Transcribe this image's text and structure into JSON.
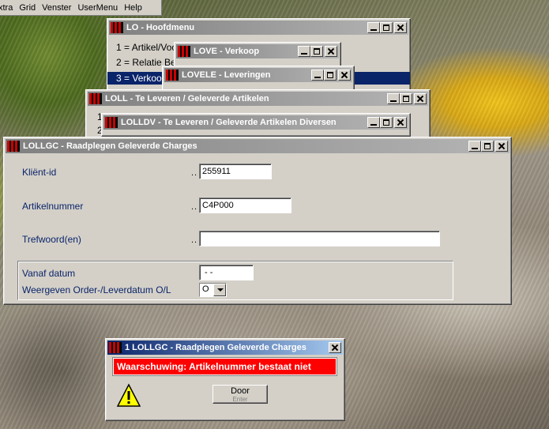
{
  "menubar": {
    "items": [
      "xtra",
      "Grid",
      "Venster",
      "UserMenu",
      "Help"
    ]
  },
  "windows": {
    "hoofdmenu": {
      "title": "LO - Hoofdmenu",
      "items": [
        "1 = Artikel/Voo",
        "2 = Relatie Be",
        "3 = Verkoop"
      ]
    },
    "verkoop": {
      "title": "LOVE - Verkoop"
    },
    "leveringen": {
      "title": "LOVELE - Leveringen"
    },
    "loll": {
      "title": "LOLL - Te Leveren / Geleverde Artikelen",
      "items": [
        "1",
        "2"
      ]
    },
    "lolldv": {
      "title": "LOLLDV - Te Leveren / Geleverde Artikelen Diversen"
    },
    "lollgc": {
      "title": "LOLLGC - Raadplegen Geleverde Charges",
      "form": {
        "klient_label": "Kliënt-id",
        "klient_value": "255911",
        "artikel_label": "Artikelnummer",
        "artikel_value": "C4P000",
        "trefwoord_label": "Trefwoord(en)",
        "trefwoord_value": "",
        "vanaf_label": "Vanaf datum",
        "vanaf_value": " - -",
        "weergeven_label": "Weergeven Order-/Leverdatum O/L",
        "weergeven_value": "O",
        "dots": ".."
      }
    }
  },
  "dialog": {
    "title": "1 LOLLGC - Raadplegen Geleverde Charges",
    "warning": "Waarschuwing: Artikelnummer bestaat niet",
    "button_label": "Door",
    "button_hint": "Enter"
  },
  "colors": {
    "title_inactive": "#808080",
    "selection": "#0a246a",
    "warning_bg": "#ff0000",
    "label_blue": "#0a246a"
  }
}
